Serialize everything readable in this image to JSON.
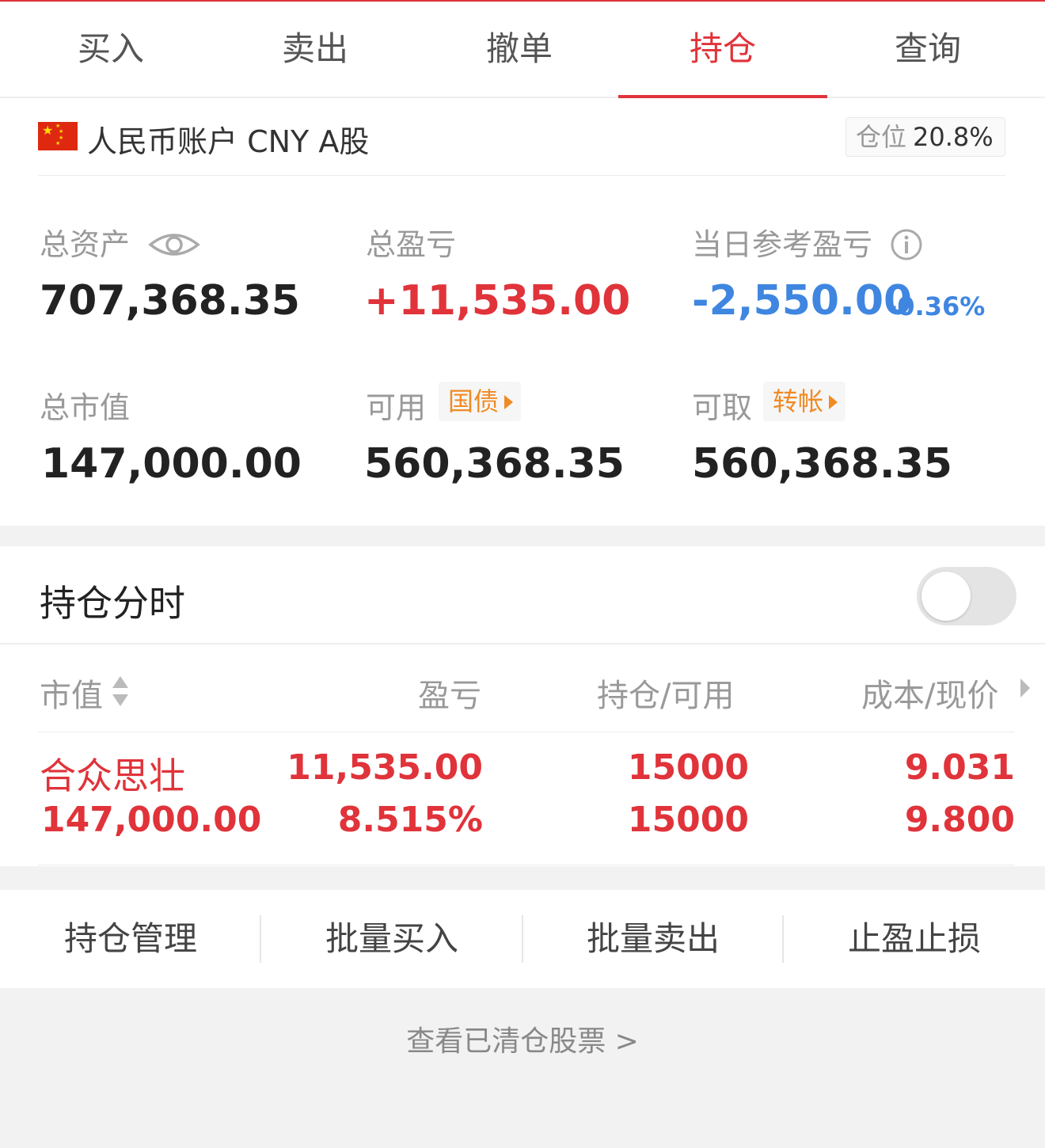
{
  "tabs": [
    {
      "label": "买入"
    },
    {
      "label": "卖出"
    },
    {
      "label": "撤单"
    },
    {
      "label": "持仓",
      "active": true
    },
    {
      "label": "查询"
    }
  ],
  "account": {
    "name": "人民币账户 CNY A股",
    "position_label": "仓位",
    "position_value": "20.8%"
  },
  "metrics": {
    "total_assets": {
      "label": "总资产",
      "value": "707,368.35"
    },
    "total_pnl": {
      "label": "总盈亏",
      "value": "+11,535.00"
    },
    "day_pnl": {
      "label": "当日参考盈亏",
      "value": "-2,550.00",
      "pct": "-0.36%"
    },
    "market_value": {
      "label": "总市值",
      "value": "147,000.00"
    },
    "available": {
      "label": "可用",
      "button": "国债",
      "value": "560,368.35"
    },
    "withdrawable": {
      "label": "可取",
      "button": "转帐",
      "value": "560,368.35"
    }
  },
  "holdings": {
    "title": "持仓分时",
    "toggle_on": false,
    "columns": [
      "市值",
      "盈亏",
      "持仓/可用",
      "成本/现价"
    ],
    "rows": [
      {
        "name": "合众思壮",
        "market_value": "147,000.00",
        "pnl": "11,535.00",
        "pnl_pct": "8.515%",
        "position": "15000",
        "available": "15000",
        "cost": "9.031",
        "price": "9.800"
      }
    ]
  },
  "actions": [
    "持仓管理",
    "批量买入",
    "批量卖出",
    "止盈止损"
  ],
  "cleared_link": "查看已清仓股票 >",
  "colors": {
    "accent": "#e0333a",
    "down": "#3f86e0",
    "orange": "#f08a24"
  }
}
